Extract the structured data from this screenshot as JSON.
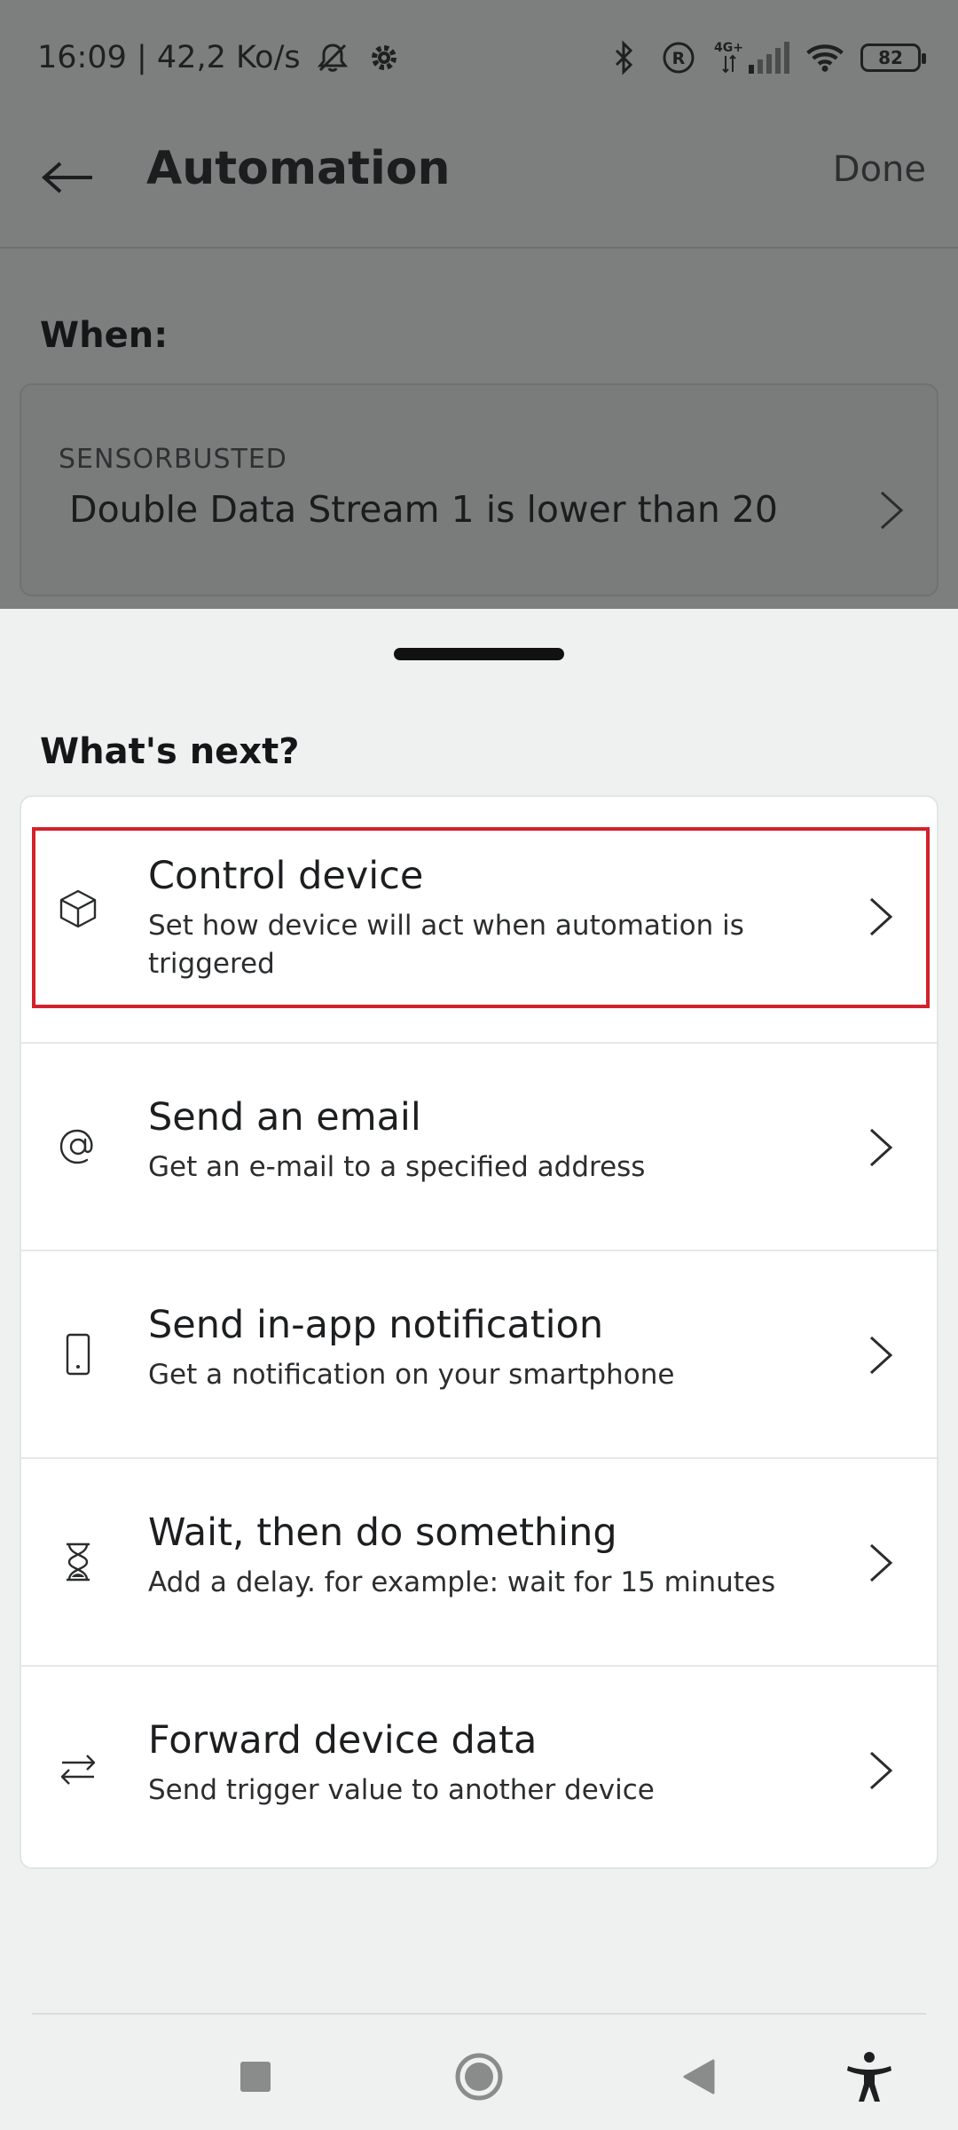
{
  "status_bar": {
    "time_speed": "16:09 | 42,2 Ko/s",
    "network_label": "4G+",
    "battery": "82"
  },
  "app_bar": {
    "title": "Automation",
    "done_label": "Done"
  },
  "when": {
    "label": "When:",
    "device": "SENSORBUSTED",
    "condition": "Double Data Stream 1 is lower than 20"
  },
  "sheet": {
    "title": "What's next?",
    "actions": [
      {
        "title": "Control device",
        "description": "Set how device will act when automation is triggered",
        "icon": "cube-icon"
      },
      {
        "title": "Send an email",
        "description": "Get an e-mail to a specified address",
        "icon": "at-icon"
      },
      {
        "title": "Send in-app notification",
        "description": "Get a notification on your smartphone",
        "icon": "smartphone-icon"
      },
      {
        "title": "Wait, then do something",
        "description": "Add a delay. for example: wait for 15 minutes",
        "icon": "hourglass-icon"
      },
      {
        "title": "Forward device data",
        "description": "Send trigger value to another device",
        "icon": "swap-arrows-icon"
      }
    ]
  },
  "nav": {
    "icons": [
      "recents-square-icon",
      "home-circle-icon",
      "back-triangle-icon",
      "accessibility-icon"
    ]
  },
  "colors": {
    "highlight": "#d4212b",
    "scrim": "#7d7f7f",
    "sheet_background": "#eff1f1"
  }
}
